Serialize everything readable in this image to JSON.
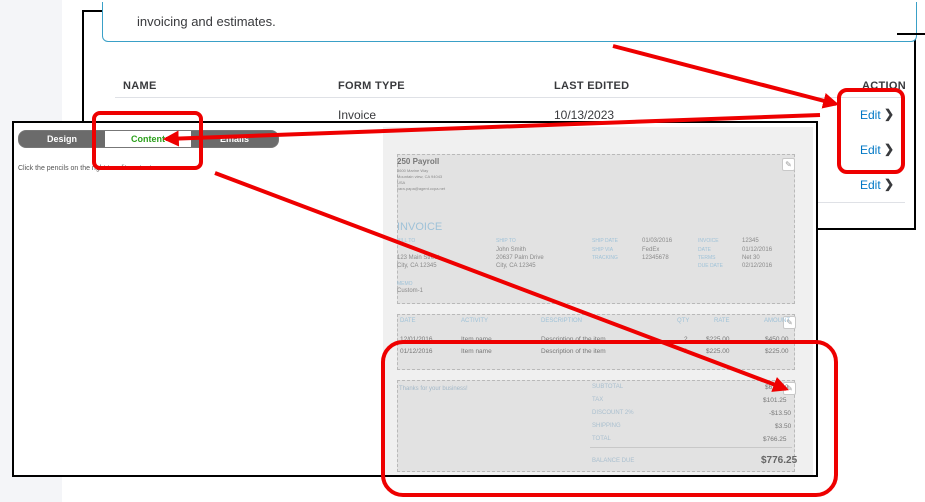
{
  "background": {
    "info_text": "invoicing and estimates.",
    "table": {
      "headers": [
        "NAME",
        "FORM TYPE",
        "LAST EDITED",
        "ACTION"
      ],
      "rows": [
        {
          "name": "",
          "form_type": "Invoice",
          "last_edited": "10/13/2023",
          "action": "Edit"
        },
        {
          "name": "",
          "form_type": "",
          "last_edited": "",
          "action": "Edit"
        },
        {
          "name": "",
          "form_type": "",
          "last_edited": "",
          "action": "Edit"
        }
      ]
    }
  },
  "editor": {
    "tabs": [
      {
        "label": "Design"
      },
      {
        "label": "Content"
      },
      {
        "label": "Emails"
      }
    ],
    "instruction": "Click the pencils on the right to edit content."
  },
  "invoice_preview": {
    "company": "250 Payroll",
    "address": [
      "3600 Marine Way",
      "Mountain view, CA 94043",
      "USA",
      "vara.papa@agent.ccpa.net"
    ],
    "title": "INVOICE",
    "bill_to_label": "BILL TO",
    "bill_to": [
      "",
      "123 Main Street",
      "City, CA 12345"
    ],
    "ship_to_label": "SHIP TO",
    "ship_to": [
      "John Smith",
      "20637 Palm Drive",
      "City, CA 12345"
    ],
    "ship_fields": [
      {
        "label": "SHIP DATE",
        "value": "01/03/2016"
      },
      {
        "label": "SHIP VIA",
        "value": "FedEx"
      },
      {
        "label": "TRACKING",
        "value": "12345678"
      }
    ],
    "invoice_fields": [
      {
        "label": "INVOICE",
        "value": "12345"
      },
      {
        "label": "DATE",
        "value": "01/12/2016"
      },
      {
        "label": "TERMS",
        "value": "Net 30"
      },
      {
        "label": "DUE DATE",
        "value": "02/12/2016"
      }
    ],
    "memo_label": "MEMO",
    "memo": "Custom-1",
    "columns": [
      "DATE",
      "ACTIVITY",
      "DESCRIPTION",
      "QTY",
      "RATE",
      "AMOUNT"
    ],
    "lines": [
      {
        "date": "12/01/2016",
        "activity": "Item name",
        "description": "Description of the item",
        "qty": "2",
        "rate": "$225.00",
        "amount": "$450.00"
      },
      {
        "date": "01/12/2016",
        "activity": "Item name",
        "description": "Description of the item",
        "qty": "1",
        "rate": "$225.00",
        "amount": "$225.00"
      }
    ],
    "footer_note": "Thanks for your business!",
    "totals": [
      {
        "label": "SUBTOTAL",
        "value": "$675.00"
      },
      {
        "label": "TAX",
        "value": "$101.25"
      },
      {
        "label": "DISCOUNT 2%",
        "value": "-$13.50"
      },
      {
        "label": "SHIPPING",
        "value": "$3.50"
      },
      {
        "label": "TOTAL",
        "value": "$766.25"
      }
    ],
    "balance_label": "BALANCE DUE",
    "balance": "$776.25"
  },
  "colors": {
    "annotation": "#ee0000",
    "edit_link": "#0077c5",
    "active_tab_text": "#2ca01c"
  }
}
